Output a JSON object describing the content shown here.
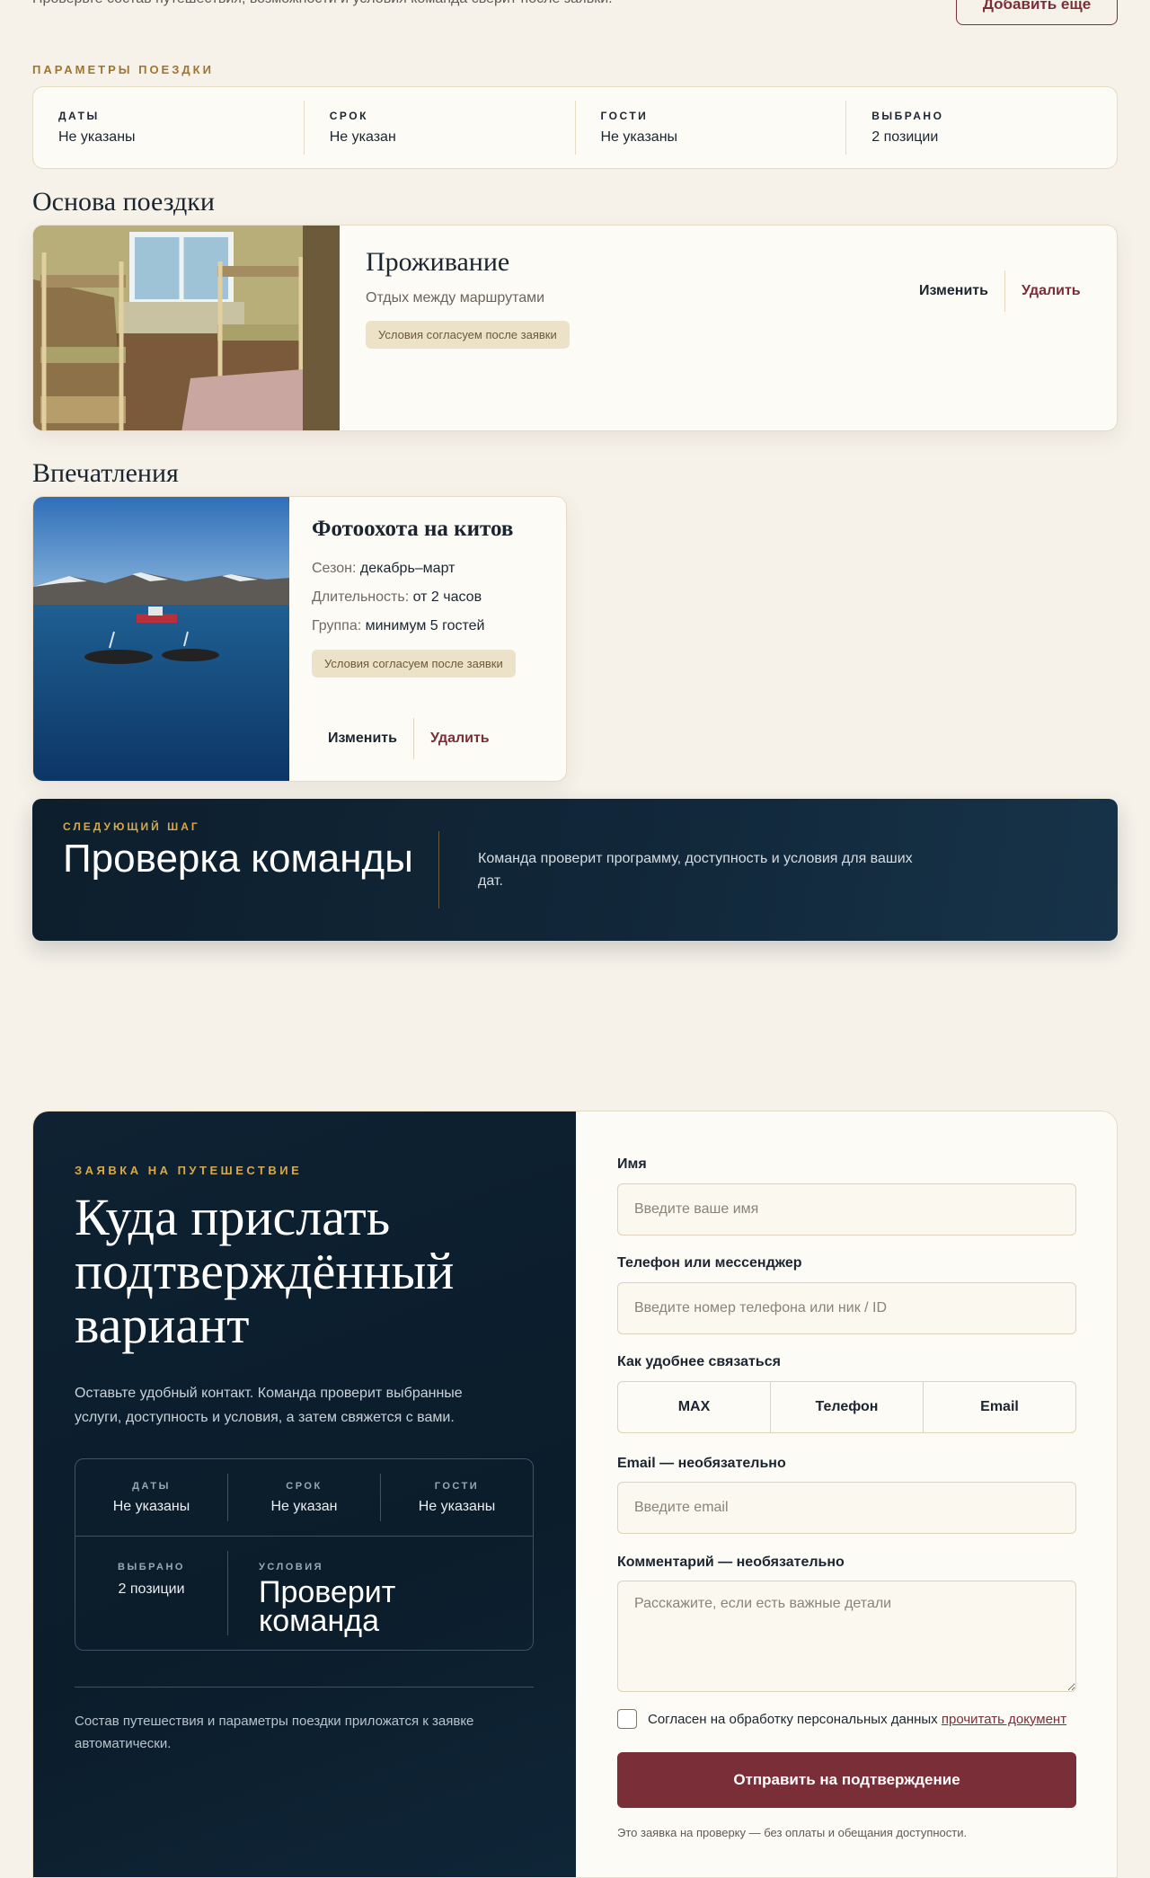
{
  "top": {
    "intro_text": "Проверьте состав путешествия, возможности и условия команда сверит после заявки.",
    "add_more_label": "Добавить еще"
  },
  "params": {
    "section_label": "Параметры поездки",
    "items": [
      {
        "key": "ДАТЫ",
        "value": "Не указаны"
      },
      {
        "key": "СРОК",
        "value": "Не указан"
      },
      {
        "key": "ГОСТИ",
        "value": "Не указаны"
      },
      {
        "key": "ВЫБРАНО",
        "value": "2 позиции"
      }
    ]
  },
  "base": {
    "section_title": "Основа поездки",
    "card": {
      "title": "Проживание",
      "subtitle": "Отдых между маршрутами",
      "chip": "Условия согласуем после заявки",
      "edit_label": "Изменить",
      "delete_label": "Удалить"
    }
  },
  "experiences": {
    "section_title": "Впечатления",
    "card": {
      "title": "Фотоохота на китов",
      "season_key": "Сезон:",
      "season_value": "декабрь–март",
      "duration_key": "Длительность:",
      "duration_value": "от 2 часов",
      "group_key": "Группа:",
      "group_value": "минимум 5 гостей",
      "chip": "Условия согласуем после заявки",
      "edit_label": "Изменить",
      "delete_label": "Удалить"
    }
  },
  "next_step": {
    "eyebrow": "Следующий шаг",
    "title": "Проверка команды",
    "text": "Команда проверит программу, доступность и условия для ваших дат."
  },
  "request": {
    "eyebrow": "Заявка на путешествие",
    "title": "Куда прислать подтверждённый вариант",
    "description": "Оставьте удобный контакт. Команда проверит выбранные услуги, доступность и условия, а затем свяжется с вами.",
    "summary": {
      "dates_key": "ДАТЫ",
      "dates_value": "Не указаны",
      "term_key": "СРОК",
      "term_value": "Не указан",
      "guests_key": "ГОСТИ",
      "guests_value": "Не указаны",
      "selected_key": "ВЫБРАНО",
      "selected_value": "2 позиции",
      "conditions_key": "УСЛОВИЯ",
      "conditions_value": "Проверит команда"
    },
    "note": "Состав путешествия и параметры поездки приложатся к заявке автоматически."
  },
  "form": {
    "name_label": "Имя",
    "name_placeholder": "Введите ваше имя",
    "phone_label": "Телефон или мессенджер",
    "phone_placeholder": "Введите номер телефона или ник / ID",
    "contact_label": "Как удобнее связаться",
    "contact_options": [
      "MAX",
      "Телефон",
      "Email"
    ],
    "email_label": "Email — необязательно",
    "email_placeholder": "Введите email",
    "comment_label": "Комментарий — необязательно",
    "comment_placeholder": "Расскажите, если есть важные детали",
    "consent_text": "Согласен на обработку персональных данных",
    "consent_link": "прочитать документ",
    "submit_label": "Отправить на подтверждение",
    "disclaimer": "Это заявка на проверку — без оплаты и обещания доступности."
  },
  "colors": {
    "accent": "#7a2e38",
    "gold": "#d6a94a",
    "navy": "#0e2233",
    "cream": "#fdfbf5"
  }
}
